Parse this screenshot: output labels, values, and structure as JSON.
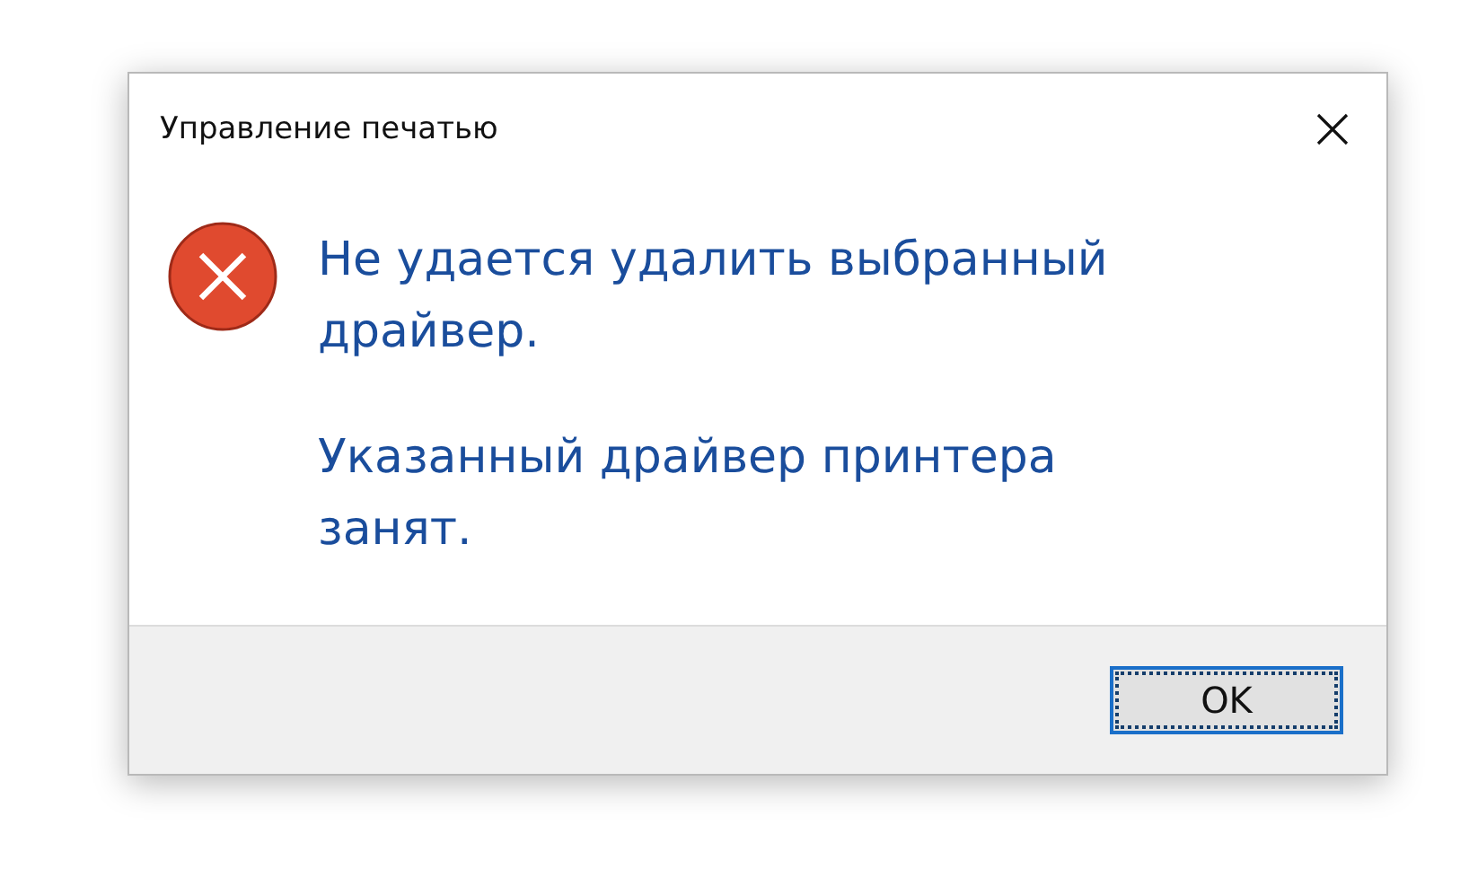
{
  "window": {
    "title": "Управление печатью"
  },
  "icon": {
    "kind": "error"
  },
  "messages": [
    "Не удается удалить выбранный драйвер.",
    "Указанный драйвер принтера занят."
  ],
  "buttons": [
    {
      "label": "OK",
      "focused": true
    }
  ]
}
